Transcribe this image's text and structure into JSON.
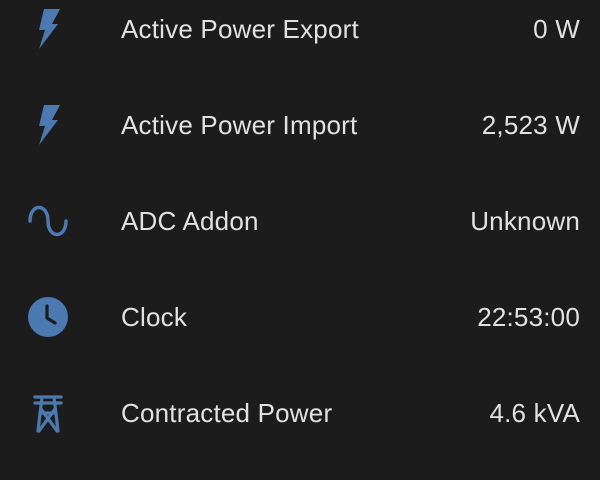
{
  "accent_color": "#4a7ab0",
  "entities": [
    {
      "icon": "flash-icon",
      "label": "Active Power Export",
      "value": "0 W"
    },
    {
      "icon": "flash-icon",
      "label": "Active Power Import",
      "value": "2,523 W"
    },
    {
      "icon": "sine-wave-icon",
      "label": "ADC Addon",
      "value": "Unknown"
    },
    {
      "icon": "clock-icon",
      "label": "Clock",
      "value": "22:53:00"
    },
    {
      "icon": "transmission-tower-icon",
      "label": "Contracted Power",
      "value": "4.6 kVA"
    }
  ]
}
